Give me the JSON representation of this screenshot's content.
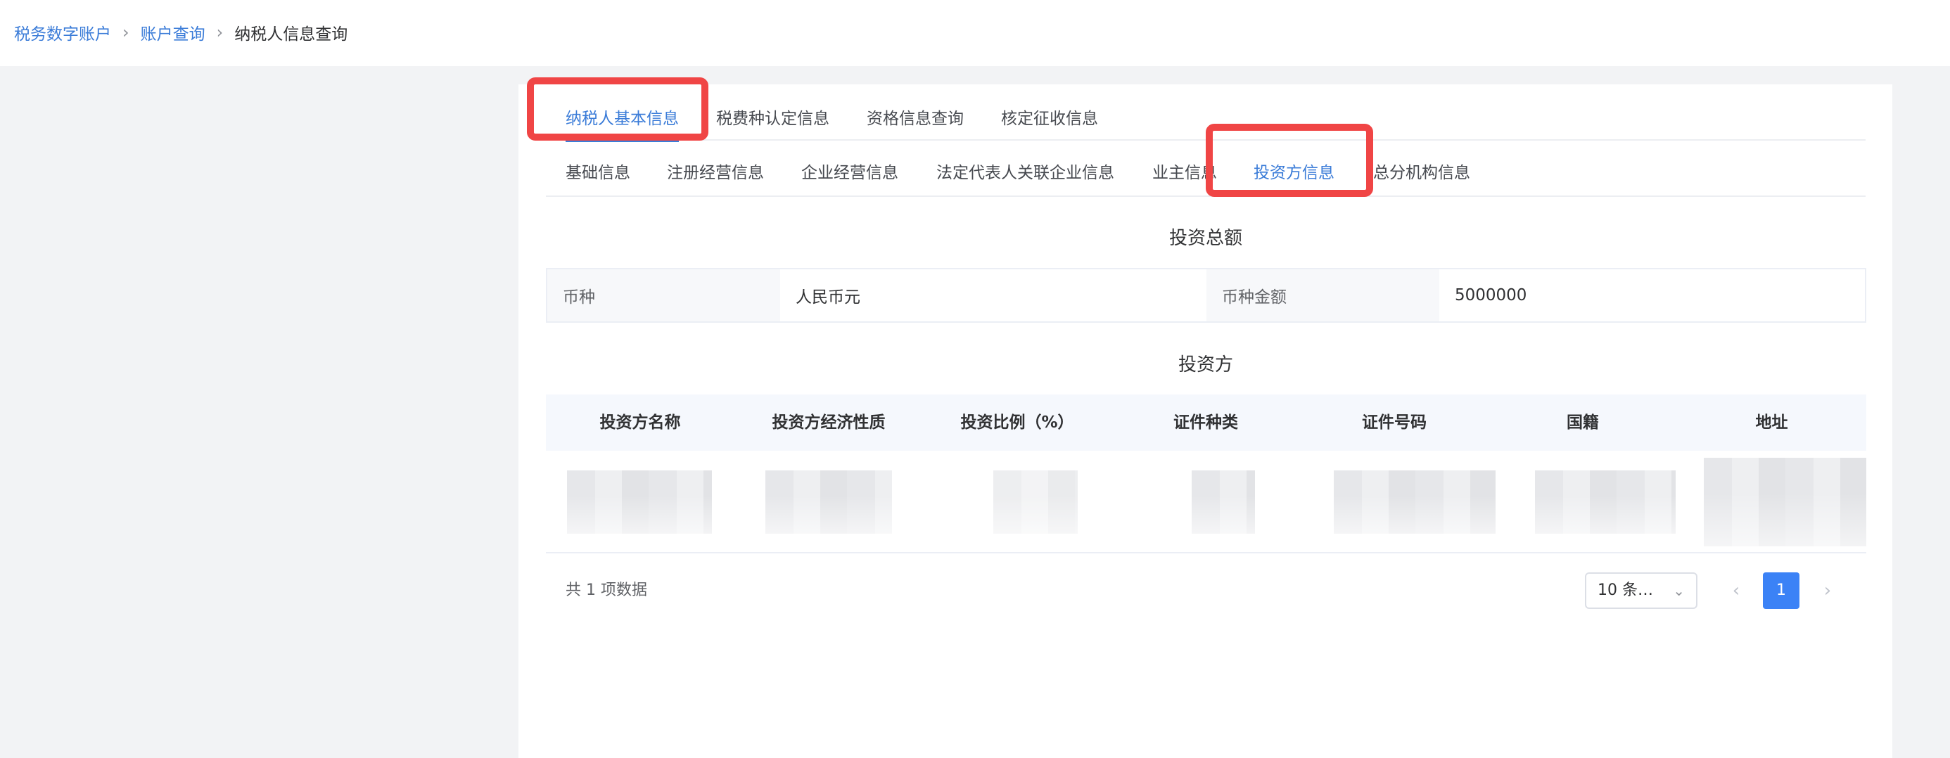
{
  "breadcrumb": {
    "items": [
      "税务数字账户",
      "账户查询"
    ],
    "current": "纳税人信息查询",
    "separator": "›"
  },
  "main_tabs": [
    {
      "label": "纳税人基本信息",
      "active": true
    },
    {
      "label": "税费种认定信息"
    },
    {
      "label": "资格信息查询"
    },
    {
      "label": "核定征收信息"
    }
  ],
  "sub_tabs": [
    {
      "label": "基础信息"
    },
    {
      "label": "注册经营信息"
    },
    {
      "label": "企业经营信息"
    },
    {
      "label": "法定代表人关联企业信息"
    },
    {
      "label": "业主信息"
    },
    {
      "label": "投资方信息",
      "active": true
    },
    {
      "label": "总分机构信息"
    }
  ],
  "investment_total": {
    "title": "投资总额",
    "currency_label": "币种",
    "currency_value": "人民币元",
    "amount_label": "币种金额",
    "amount_value": "5000000"
  },
  "investors": {
    "title": "投资方",
    "columns": [
      "投资方名称",
      "投资方经济性质",
      "投资比例（%）",
      "证件种类",
      "证件号码",
      "国籍",
      "地址"
    ],
    "rows_blurred": 1
  },
  "pagination": {
    "total_text": "共 1 项数据",
    "page_size": "10 条…",
    "current_page": "1",
    "prev_icon": "‹",
    "next_icon": "›",
    "chevron": "⌄"
  },
  "colors": {
    "accent": "#3b7cd8",
    "highlight": "#f04545",
    "page_button": "#3b82f6"
  }
}
